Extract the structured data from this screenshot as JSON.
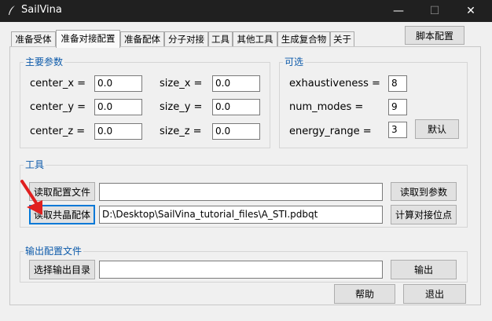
{
  "window": {
    "title": "SailVina",
    "minimize_glyph": "—",
    "maximize_glyph": "☐",
    "close_glyph": "✕"
  },
  "tabs": [
    {
      "label": "准备受体"
    },
    {
      "label": "准备对接配置"
    },
    {
      "label": "准备配体"
    },
    {
      "label": "分子对接"
    },
    {
      "label": "工具"
    },
    {
      "label": "其他工具"
    },
    {
      "label": "生成复合物"
    },
    {
      "label": "关于"
    }
  ],
  "active_tab": 1,
  "script_config_button": "脚本配置",
  "main_params": {
    "title": "主要参数",
    "center_x_label": "center_x =",
    "center_x_value": "0.0",
    "center_y_label": "center_y =",
    "center_y_value": "0.0",
    "center_z_label": "center_z =",
    "center_z_value": "0.0",
    "size_x_label": "size_x =",
    "size_x_value": "0.0",
    "size_y_label": "size_y =",
    "size_y_value": "0.0",
    "size_z_label": "size_z =",
    "size_z_value": "0.0"
  },
  "optional": {
    "title": "可选",
    "exhaustiveness_label": "exhaustiveness =",
    "exhaustiveness_value": "8",
    "num_modes_label": "num_modes =",
    "num_modes_value": "9",
    "energy_range_label": "energy_range =",
    "energy_range_value": "3",
    "default_button": "默认"
  },
  "tools": {
    "title": "工具",
    "read_config_button": "读取配置文件",
    "read_config_value": "",
    "read_to_params_button": "读取到参数",
    "read_ligand_button": "读取共晶配体",
    "ligand_path_value": "D:\\Desktop\\SailVina_tutorial_files\\A_STI.pdbqt",
    "calc_site_button": "计算对接位点"
  },
  "output": {
    "title": "输出配置文件",
    "select_dir_button": "选择输出目录",
    "dir_value": "",
    "output_button": "输出"
  },
  "help_button": "帮助",
  "exit_button": "退出",
  "colors": {
    "group_title": "#0c5aaa",
    "arrow": "#e02020",
    "titlebar": "#202020",
    "focus_border": "#0078d7"
  }
}
